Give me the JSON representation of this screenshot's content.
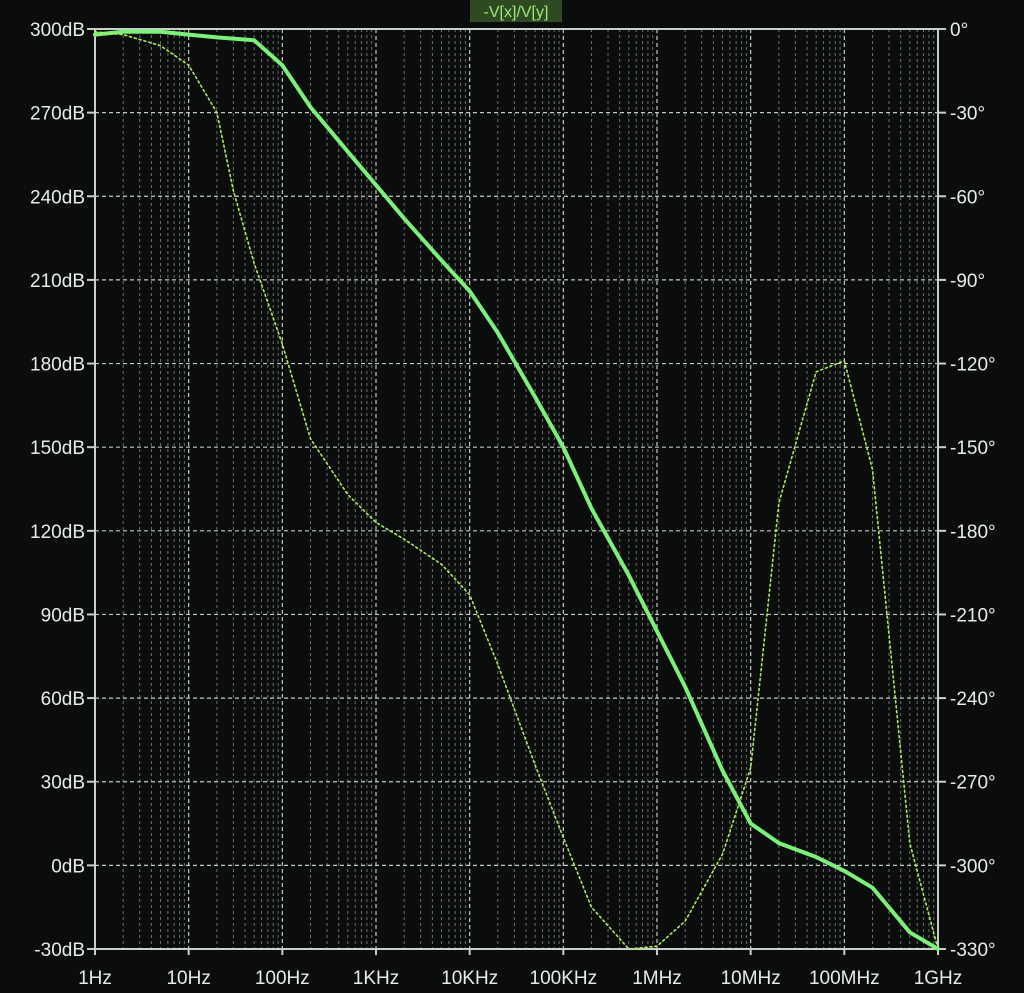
{
  "chart_data": {
    "type": "line",
    "title": "-V[x]/V[y]",
    "x_scale": "log",
    "x_ticks": [
      "1Hz",
      "10Hz",
      "100Hz",
      "1KHz",
      "10KHz",
      "100KHz",
      "1MHz",
      "10MHz",
      "100MHz",
      "1GHz"
    ],
    "y_left_ticks": [
      "300dB",
      "270dB",
      "240dB",
      "210dB",
      "180dB",
      "150dB",
      "120dB",
      "90dB",
      "60dB",
      "30dB",
      "0dB",
      "-30dB"
    ],
    "y_right_ticks": [
      "0°",
      "-30°",
      "-60°",
      "-90°",
      "-120°",
      "-150°",
      "-180°",
      "-210°",
      "-240°",
      "-270°",
      "-300°",
      "-330°"
    ],
    "xlim_hz": [
      1,
      1000000000
    ],
    "ylim_left_db": [
      -30,
      300
    ],
    "ylim_right_deg": [
      -330,
      0
    ],
    "grid": true,
    "series": [
      {
        "axis": "left",
        "style": "solid",
        "color": "#7CF07A",
        "x": [
          1,
          2,
          5,
          10,
          20,
          50,
          100,
          200,
          500,
          1000,
          2000,
          5000,
          10000,
          20000,
          50000,
          100000,
          200000,
          500000,
          1000000,
          2000000,
          5000000,
          10000000,
          20000000,
          50000000,
          100000000,
          200000000,
          500000000,
          1000000000
        ],
        "values": [
          298,
          299,
          299,
          298,
          297,
          296,
          287,
          272,
          256,
          244,
          232,
          217,
          206,
          191,
          168,
          150,
          128,
          104,
          84,
          64,
          34,
          15,
          8,
          3,
          -2,
          -8,
          -24,
          -30
        ]
      },
      {
        "axis": "right",
        "style": "dotted",
        "color": "#A8EE5A",
        "x": [
          1,
          2,
          5,
          10,
          20,
          30,
          50,
          100,
          200,
          500,
          1000,
          2000,
          5000,
          10000,
          20000,
          50000,
          100000,
          200000,
          500000,
          1000000,
          2000000,
          5000000,
          10000000,
          20000000,
          50000000,
          100000000,
          200000000,
          500000000,
          1000000000
        ],
        "values": [
          -1,
          -2,
          -6,
          -13,
          -30,
          -58,
          -84,
          -113,
          -147,
          -167,
          -177,
          -183,
          -192,
          -203,
          -228,
          -264,
          -290,
          -315,
          -330,
          -329,
          -320,
          -296,
          -265,
          -170,
          -123,
          -119,
          -158,
          -292,
          -330
        ]
      }
    ]
  }
}
